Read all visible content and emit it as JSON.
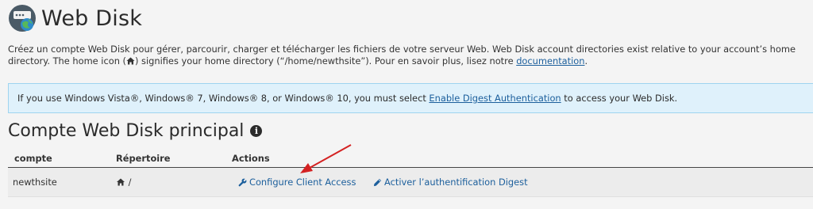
{
  "page": {
    "title": "Web Disk",
    "description": {
      "before_home_icon": "Créez un compte Web Disk pour gérer, parcourir, charger et télécharger les fichiers de votre serveur Web. Web Disk account directories exist relative to your account’s home directory. The home icon (",
      "after_home_icon": ") signifies your home directory (“/home/newthsite”). Pour en savoir plus, lisez notre ",
      "doc_link": "documentation",
      "end": "."
    }
  },
  "alert": {
    "before_link": "If you use Windows Vista®, Windows® 7, Windows® 8, or Windows® 10, you must select ",
    "link": "Enable Digest Authentication",
    "after_link": " to access your Web Disk."
  },
  "section": {
    "title": "Compte Web Disk principal"
  },
  "table": {
    "headers": [
      "compte",
      "Répertoire",
      "Actions"
    ],
    "rows": [
      {
        "account": "newthsite",
        "directory": "/",
        "actions": [
          "Configure Client Access",
          "Activer l’authentification Digest"
        ]
      }
    ]
  },
  "icons": {
    "app": "web-disk-icon",
    "info": "info-icon",
    "home": "home-icon",
    "wrench": "wrench-icon",
    "pencil": "pencil-icon",
    "annotation_arrow_color": "#d42222"
  },
  "colors": {
    "link": "#1c5f9c",
    "alert_bg": "#dff1fb",
    "alert_border": "#9fd4ef"
  }
}
